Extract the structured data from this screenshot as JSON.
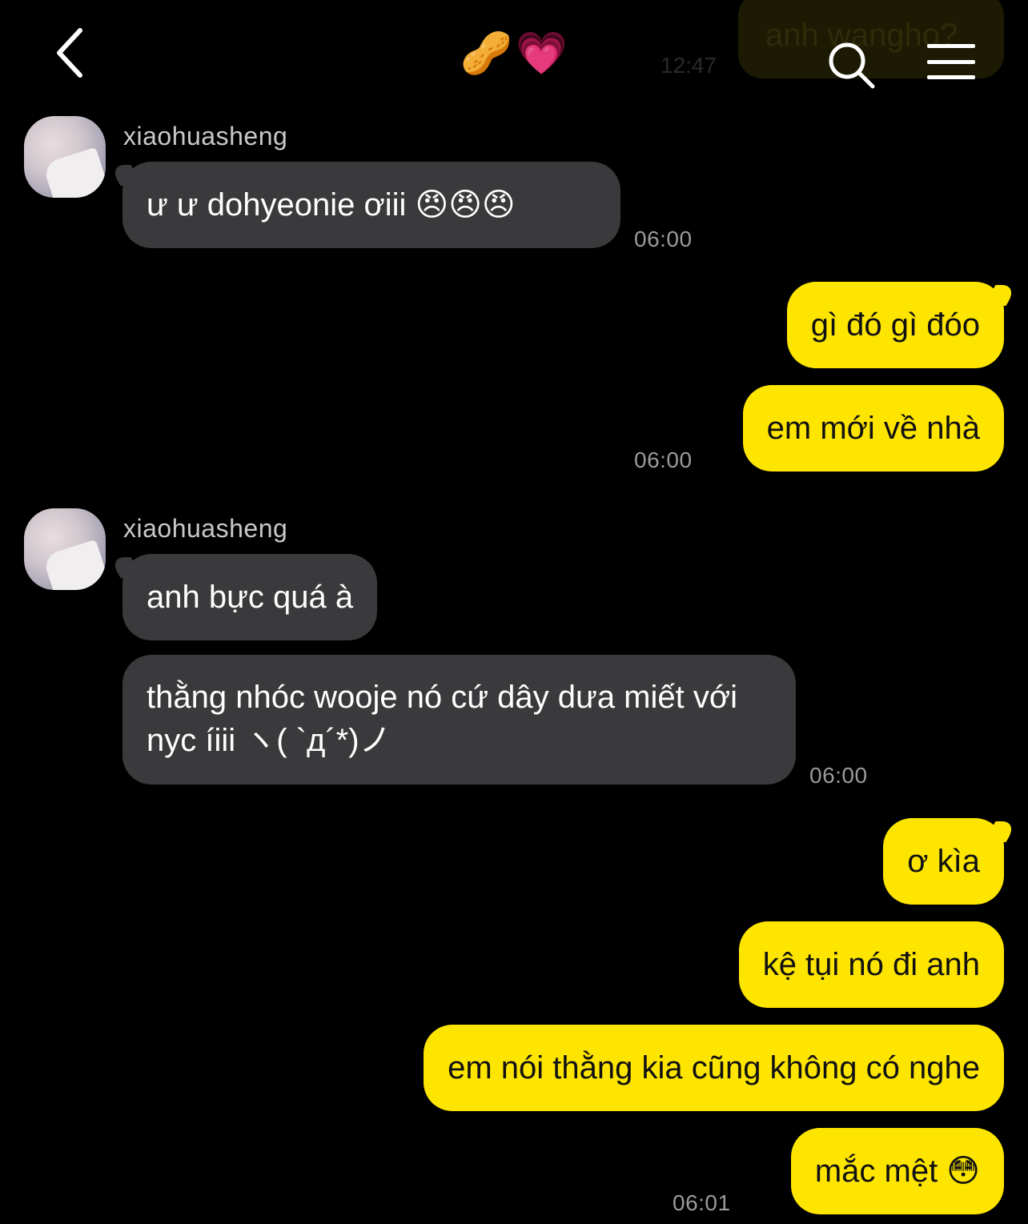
{
  "header": {
    "title_icons": [
      "🥜",
      "💗"
    ],
    "back_icon": "chevron-left",
    "search_icon": "search",
    "menu_icon": "hamburger-menu"
  },
  "ghost": {
    "text": "anh wangho?",
    "time": "12:47"
  },
  "messages": {
    "m1": {
      "sender": "xiaohuasheng",
      "text": "ư ư dohyeonie ơiii 😠😠😠",
      "time": "06:00"
    },
    "m2": {
      "text": "gì đó gì đóo"
    },
    "m3": {
      "text": "em mới về nhà",
      "time": "06:00"
    },
    "m4": {
      "sender": "xiaohuasheng",
      "text": "anh bực quá à"
    },
    "m5": {
      "text": "thằng nhóc wooje nó cứ dây dưa miết với nyc íiii ヽ( `д´*)ノ",
      "time": "06:00"
    },
    "m6": {
      "text": "ơ kìa"
    },
    "m7": {
      "text": "kệ tụi nó đi anh"
    },
    "m8": {
      "text": "em nói thằng kia cũng không có nghe"
    },
    "m9": {
      "text": "mắc mệt 😳",
      "time": "06:01"
    }
  },
  "colors": {
    "background": "#000000",
    "incoming_bubble": "#3a3a3c",
    "outgoing_bubble": "#fee500",
    "timestamp": "#9a9a9a",
    "sender_name": "#c9c9c9"
  }
}
